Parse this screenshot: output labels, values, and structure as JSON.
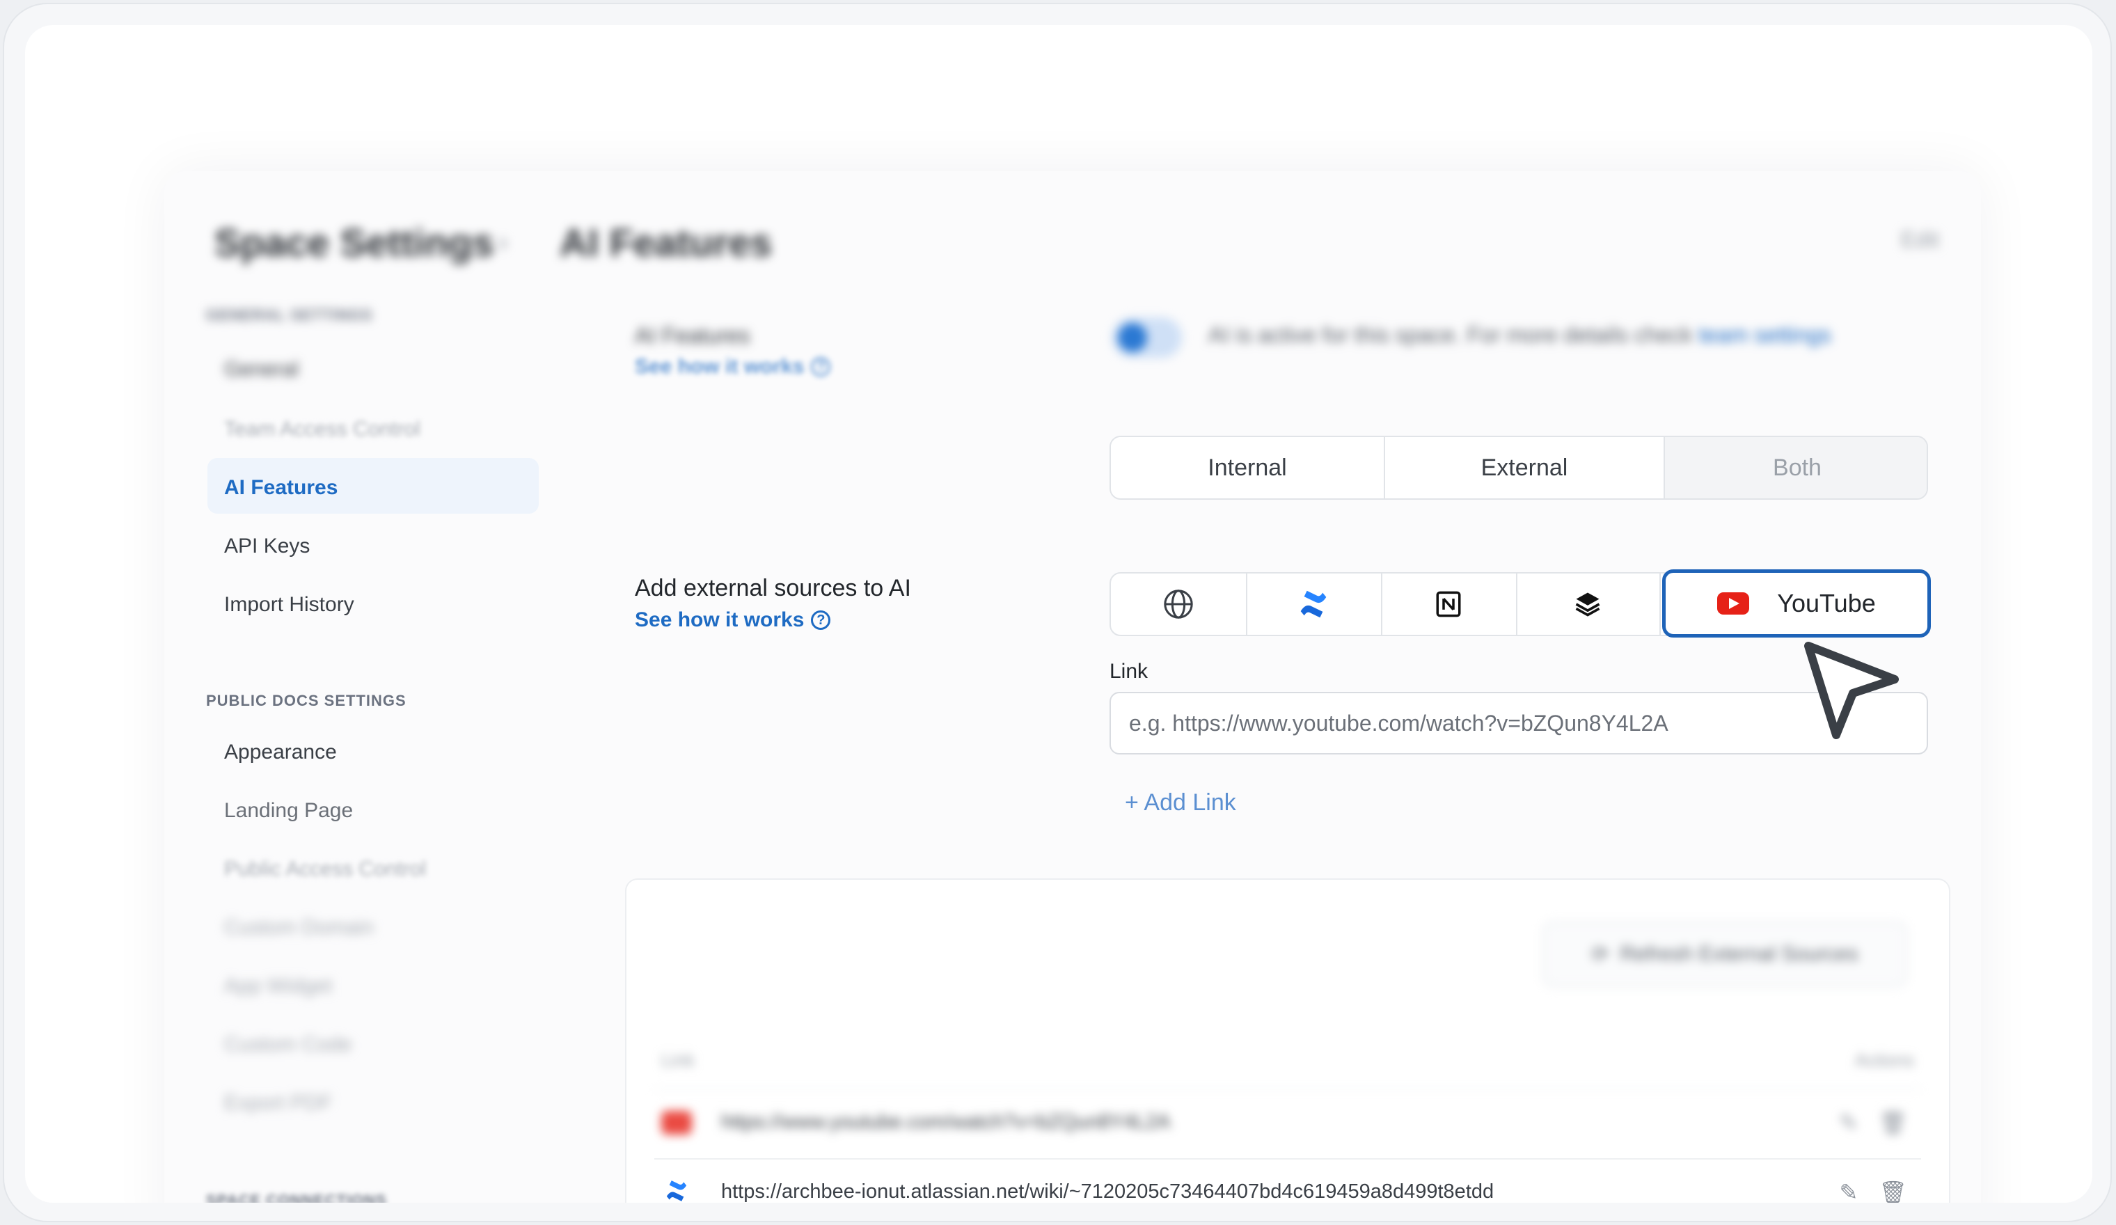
{
  "header": {
    "title": "Space Settings",
    "subtitle": "AI Features",
    "right_label": "Edit"
  },
  "sidebar": {
    "sections": [
      {
        "heading": "GENERAL SETTINGS",
        "items": [
          {
            "label": "General"
          },
          {
            "label": "Team Access Control"
          },
          {
            "label": "AI Features",
            "active": true
          },
          {
            "label": "API Keys"
          },
          {
            "label": "Import History"
          }
        ]
      },
      {
        "heading": "PUBLIC DOCS SETTINGS",
        "items": [
          {
            "label": "Appearance"
          },
          {
            "label": "Landing Page"
          },
          {
            "label": "Public Access Control"
          },
          {
            "label": "Custom Domain"
          },
          {
            "label": "App Widget"
          },
          {
            "label": "Custom Code"
          },
          {
            "label": "Export PDF"
          }
        ]
      },
      {
        "heading": "SPACE CONNECTIONS",
        "items": []
      }
    ]
  },
  "ai_features": {
    "label": "AI Features",
    "help_link": "See how it works",
    "toggle_on": true,
    "toggle_text": "AI is active for this space. For more details check",
    "toggle_link": "team settings"
  },
  "scope_tabs": [
    "Internal",
    "External",
    "Both"
  ],
  "external_sources": {
    "label": "Add external sources to AI",
    "help_link": "See how it works",
    "source_icons": [
      "globe-icon",
      "confluence-icon",
      "notion-icon",
      "gitbook-icon"
    ],
    "selected_source": "YouTube",
    "link_label": "Link",
    "link_placeholder": "e.g. https://www.youtube.com/watch?v=bZQun8Y4L2A",
    "add_link_label": "+ Add Link"
  },
  "sources_table": {
    "refresh_label": "Refresh External Sources",
    "columns": [
      "Link",
      "Actions"
    ],
    "rows": [
      {
        "type": "youtube",
        "url": "https://www.youtube.com/watch?v=bZQun8Y4L2A"
      },
      {
        "type": "confluence",
        "url": "https://archbee-ionut.atlassian.net/wiki/~7120205c73464407bd4c619459a8d499t8etdd"
      }
    ]
  },
  "colors": {
    "accent": "#1e6bc3",
    "selected_border": "#1e63b8",
    "youtube_red": "#e62117"
  }
}
